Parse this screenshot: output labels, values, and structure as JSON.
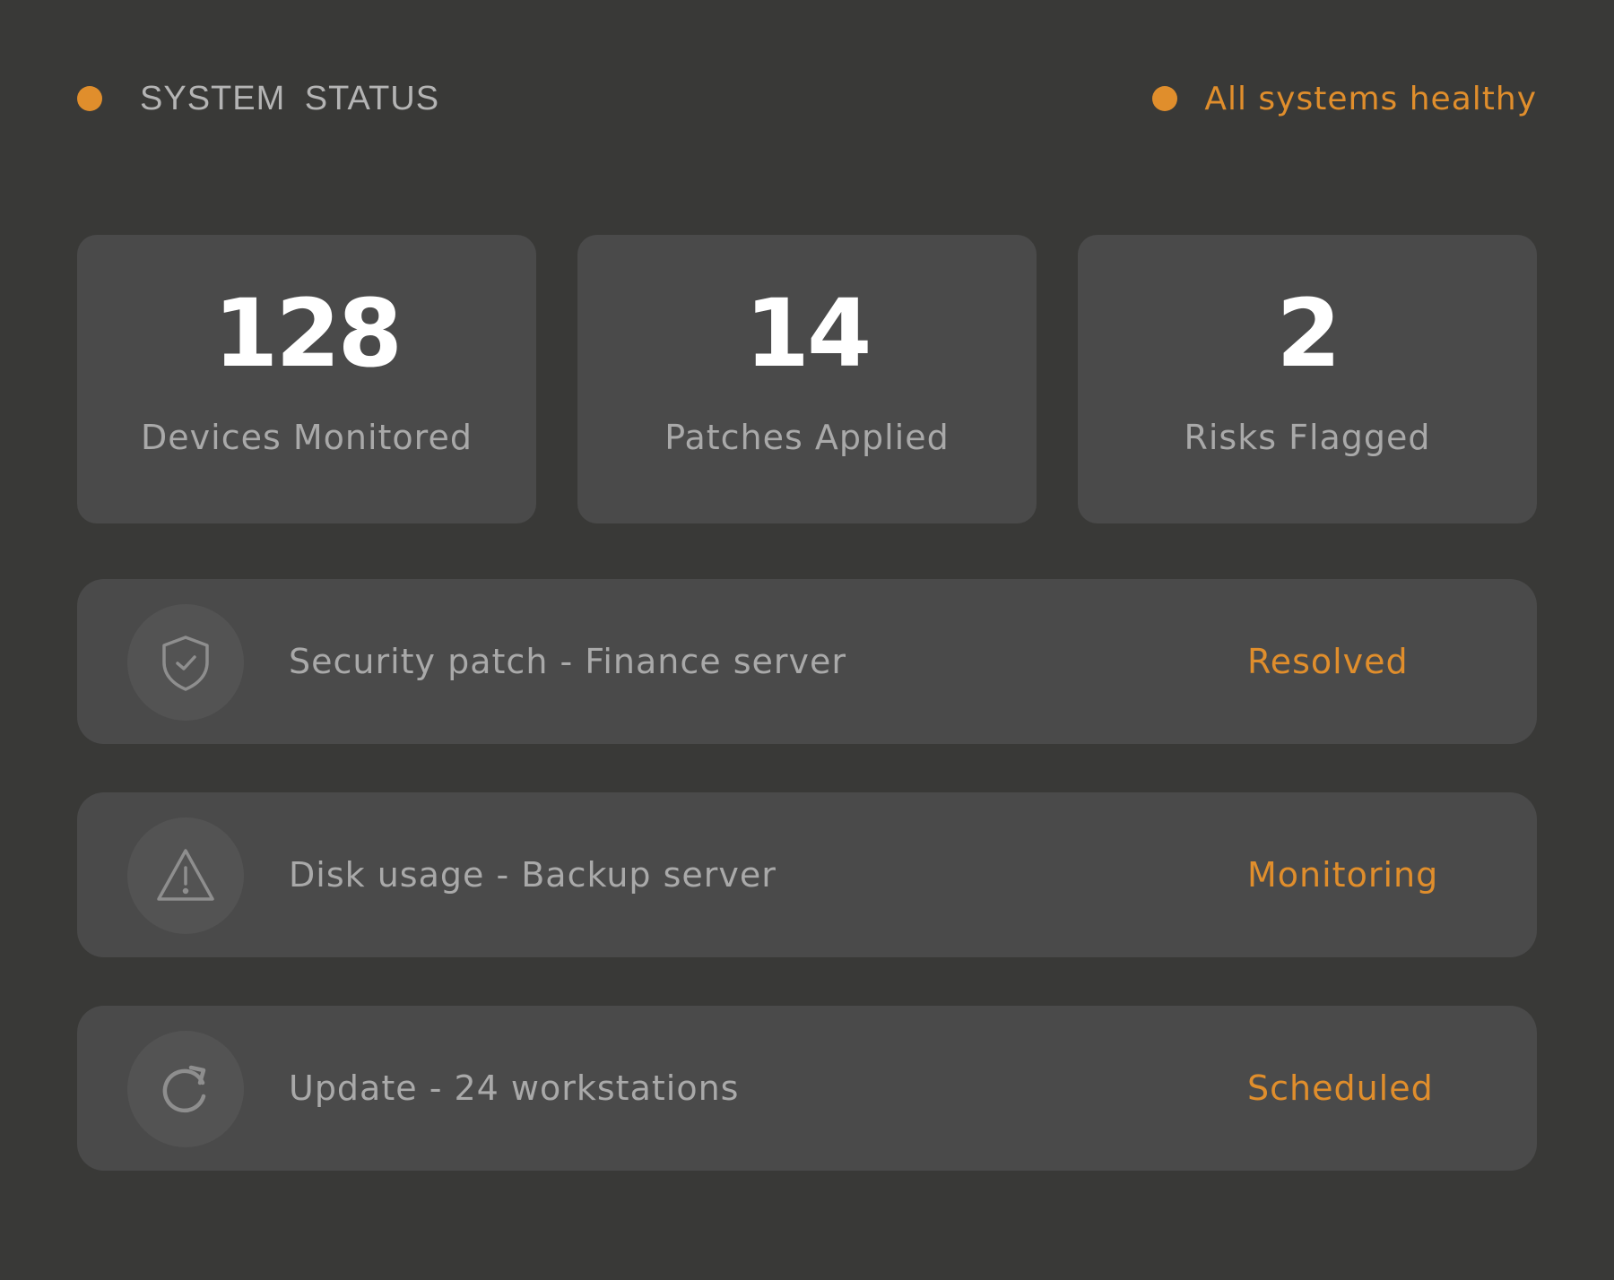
{
  "header": {
    "title": "SYSTEM STATUS",
    "health_text": "All systems healthy",
    "accent_color": "#e08e2c"
  },
  "stats": [
    {
      "value": "128",
      "label": "Devices Monitored"
    },
    {
      "value": "14",
      "label": "Patches Applied"
    },
    {
      "value": "2",
      "label": "Risks Flagged"
    }
  ],
  "events": [
    {
      "icon": "shield-check-icon",
      "label": "Security patch - Finance server",
      "status": "Resolved"
    },
    {
      "icon": "warning-icon",
      "label": "Disk usage - Backup server",
      "status": "Monitoring"
    },
    {
      "icon": "refresh-icon",
      "label": "Update - 24 workstations",
      "status": "Scheduled"
    }
  ]
}
